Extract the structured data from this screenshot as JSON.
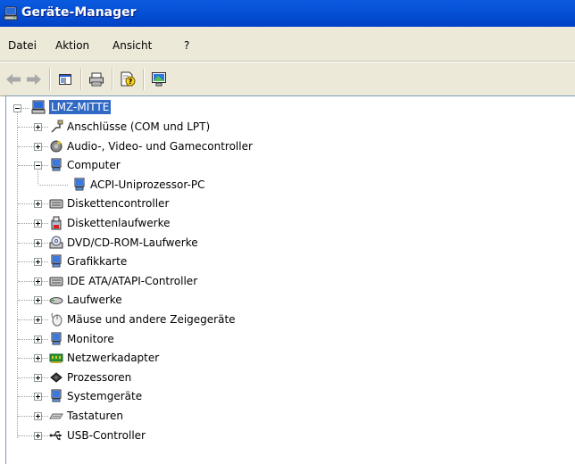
{
  "window": {
    "title": "Geräte-Manager"
  },
  "menu": [
    "Datei",
    "Aktion",
    "Ansicht",
    "?"
  ],
  "tree": {
    "root": "LMZ-MITTE",
    "items": [
      {
        "label": "Anschlüsse (COM und LPT)",
        "icon": "port-icon",
        "expanded": false
      },
      {
        "label": "Audio-, Video- und Gamecontroller",
        "icon": "speaker-icon",
        "expanded": false
      },
      {
        "label": "Computer",
        "icon": "computer-icon",
        "expanded": true,
        "children": [
          "ACPI-Uniprozessor-PC"
        ]
      },
      {
        "label": "Diskettencontroller",
        "icon": "disk-controller-icon",
        "expanded": false
      },
      {
        "label": "Diskettenlaufwerke",
        "icon": "floppy-icon",
        "expanded": false
      },
      {
        "label": "DVD/CD-ROM-Laufwerke",
        "icon": "cdrom-icon",
        "expanded": false
      },
      {
        "label": "Grafikkarte",
        "icon": "display-adapter-icon",
        "expanded": false
      },
      {
        "label": "IDE ATA/ATAPI-Controller",
        "icon": "ide-controller-icon",
        "expanded": false
      },
      {
        "label": "Laufwerke",
        "icon": "drive-icon",
        "expanded": false
      },
      {
        "label": "Mäuse und andere Zeigegeräte",
        "icon": "mouse-icon",
        "expanded": false
      },
      {
        "label": "Monitore",
        "icon": "monitor-icon",
        "expanded": false
      },
      {
        "label": "Netzwerkadapter",
        "icon": "network-adapter-icon",
        "expanded": false
      },
      {
        "label": "Prozessoren",
        "icon": "processor-icon",
        "expanded": false
      },
      {
        "label": "Systemgeräte",
        "icon": "system-device-icon",
        "expanded": false
      },
      {
        "label": "Tastaturen",
        "icon": "keyboard-icon",
        "expanded": false
      },
      {
        "label": "USB-Controller",
        "icon": "usb-icon",
        "expanded": false
      }
    ]
  }
}
